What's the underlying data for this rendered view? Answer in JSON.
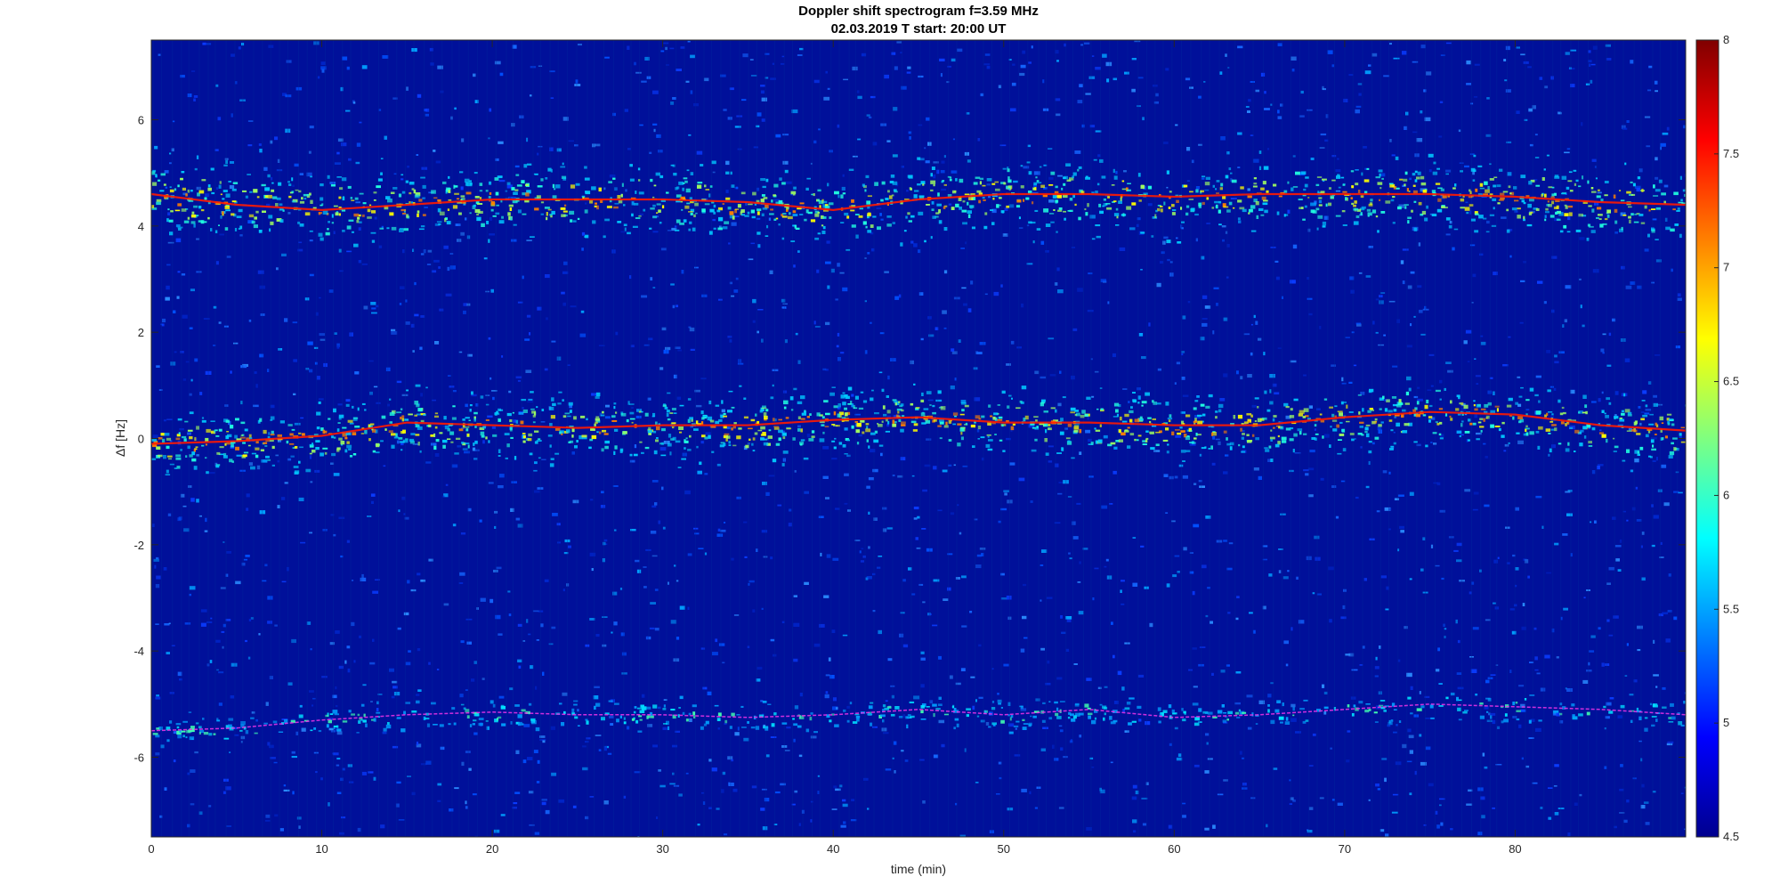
{
  "chart_data": {
    "type": "heatmap",
    "title": "Doppler shift spectrogram f=3.59 MHz",
    "subtitle": "02.03.2019    T start: 20:00 UT",
    "xlabel": "time (min)",
    "ylabel": "Δf [Hz]",
    "xlim": [
      0,
      90
    ],
    "ylim": [
      -7.5,
      7.5
    ],
    "x_ticks": [
      0,
      10,
      20,
      30,
      40,
      50,
      60,
      70,
      80
    ],
    "x_tick_labels": [
      "0",
      "10",
      "20",
      "30",
      "40",
      "50",
      "60",
      "70",
      "80"
    ],
    "y_ticks": [
      -6,
      -4,
      -2,
      0,
      2,
      4,
      6
    ],
    "y_tick_labels": [
      "-6",
      "-4",
      "-2",
      "0",
      "2",
      "4",
      "6"
    ],
    "colorbar": {
      "range": [
        4.5,
        8
      ],
      "ticks": [
        4.5,
        5,
        5.5,
        6,
        6.5,
        7,
        7.5,
        8
      ],
      "tick_labels": [
        "4.5",
        "5",
        "5.5",
        "6",
        "6.5",
        "7",
        "7.5",
        "8"
      ],
      "colormap": "jet"
    },
    "grid": false,
    "series": [
      {
        "x": [
          0,
          5,
          10,
          15,
          20,
          25,
          30,
          35,
          40,
          45,
          50,
          55,
          60,
          65,
          70,
          75,
          80,
          85,
          90
        ],
        "y": [
          4.6,
          4.4,
          4.3,
          4.4,
          4.5,
          4.5,
          4.5,
          4.45,
          4.3,
          4.5,
          4.6,
          4.6,
          4.55,
          4.6,
          4.6,
          4.6,
          4.55,
          4.45,
          4.4
        ],
        "color": "#ff1a00"
      },
      {
        "x": [
          0,
          5,
          10,
          15,
          20,
          25,
          30,
          35,
          40,
          45,
          50,
          55,
          60,
          65,
          70,
          75,
          80,
          85,
          90
        ],
        "y": [
          -0.1,
          -0.05,
          0.05,
          0.3,
          0.25,
          0.2,
          0.25,
          0.25,
          0.35,
          0.4,
          0.3,
          0.3,
          0.25,
          0.25,
          0.4,
          0.5,
          0.45,
          0.25,
          0.15
        ],
        "color": "#ff1a00"
      },
      {
        "x": [
          0,
          5,
          10,
          15,
          20,
          25,
          30,
          35,
          40,
          45,
          50,
          55,
          60,
          65,
          70,
          75,
          80,
          85,
          90
        ],
        "y": [
          -5.5,
          -5.45,
          -5.3,
          -5.2,
          -5.15,
          -5.2,
          -5.2,
          -5.25,
          -5.2,
          -5.1,
          -5.2,
          -5.1,
          -5.25,
          -5.2,
          -5.1,
          -5.0,
          -5.05,
          -5.1,
          -5.2
        ],
        "color": "#e632e6"
      }
    ]
  }
}
